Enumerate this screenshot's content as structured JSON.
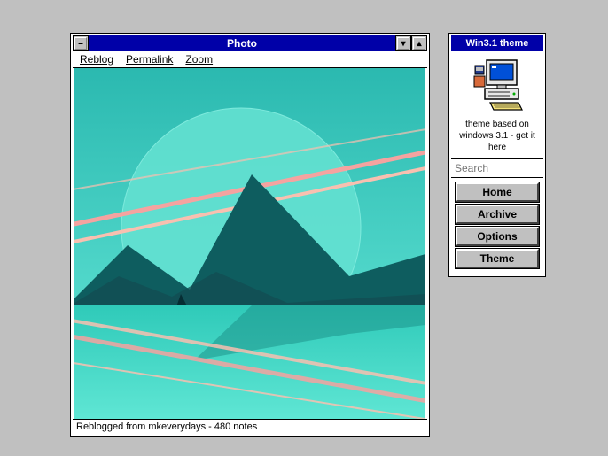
{
  "main_window": {
    "title": "Photo",
    "menu": {
      "reblog": "Reblog",
      "permalink": "Permalink",
      "zoom": "Zoom"
    },
    "status": "Reblogged from mkeverydays - 480 notes"
  },
  "sidebar": {
    "title": "Win3.1 theme",
    "tagline_line1": "theme based on",
    "tagline_line2": "windows 3.1 - get it",
    "tagline_link": "here",
    "search_placeholder": "Search",
    "nav": {
      "home": "Home",
      "archive": "Archive",
      "options": "Options",
      "theme": "Theme"
    }
  },
  "icons": {
    "sysmenu": "–",
    "min": "▾",
    "max": "▴"
  },
  "colors": {
    "titlebar": "#0000a8",
    "desktop": "#c0c0c0",
    "button": "#c0c0c0"
  },
  "artwork": {
    "description": "Stylized teal landscape: large moon, mountain silhouette, diagonal pink contrails, reflective water"
  }
}
